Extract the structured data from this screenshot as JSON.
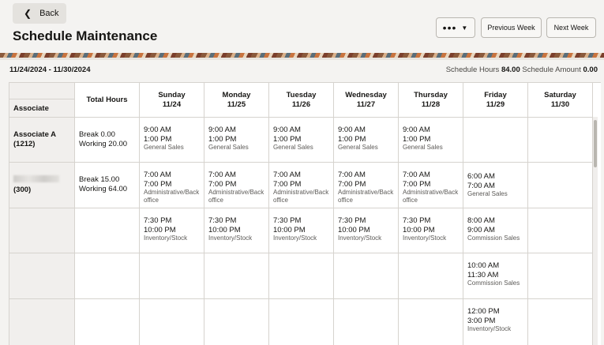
{
  "header": {
    "back_label": "Back",
    "title": "Schedule Maintenance",
    "more_label": "•••",
    "prev_label": "Previous Week",
    "next_label": "Next Week"
  },
  "summary": {
    "date_range": "11/24/2024 - 11/30/2024",
    "hours_label": "Schedule Hours",
    "hours_value": "84.00",
    "amount_label": "Schedule Amount",
    "amount_value": "0.00"
  },
  "columns": {
    "associate": "Associate",
    "total_hours": "Total Hours",
    "days": [
      {
        "name": "Sunday",
        "date": "11/24"
      },
      {
        "name": "Monday",
        "date": "11/25"
      },
      {
        "name": "Tuesday",
        "date": "11/26"
      },
      {
        "name": "Wednesday",
        "date": "11/27"
      },
      {
        "name": "Thursday",
        "date": "11/28"
      },
      {
        "name": "Friday",
        "date": "11/29"
      },
      {
        "name": "Saturday",
        "date": "11/30"
      }
    ]
  },
  "rows": [
    {
      "associate": "Associate A",
      "id": "(1212)",
      "break": "Break  0.00",
      "working": "Working  20.00",
      "shifts": [
        {
          "start": "9:00 AM",
          "end": "1:00 PM",
          "dept": "General Sales"
        },
        {
          "start": "9:00 AM",
          "end": "1:00 PM",
          "dept": "General Sales"
        },
        {
          "start": "9:00 AM",
          "end": "1:00 PM",
          "dept": "General Sales"
        },
        {
          "start": "9:00 AM",
          "end": "1:00 PM",
          "dept": "General Sales"
        },
        {
          "start": "9:00 AM",
          "end": "1:00 PM",
          "dept": "General Sales"
        },
        null,
        null
      ]
    },
    {
      "associate": "",
      "id": "(300)",
      "break": "Break  15.00",
      "working": "Working  64.00",
      "shifts": [
        {
          "start": "7:00 AM",
          "end": "7:00 PM",
          "dept": "Administrative/Back office"
        },
        {
          "start": "7:00 AM",
          "end": "7:00 PM",
          "dept": "Administrative/Back office"
        },
        {
          "start": "7:00 AM",
          "end": "7:00 PM",
          "dept": "Administrative/Back office"
        },
        {
          "start": "7:00 AM",
          "end": "7:00 PM",
          "dept": "Administrative/Back office"
        },
        {
          "start": "7:00 AM",
          "end": "7:00 PM",
          "dept": "Administrative/Back office"
        },
        {
          "start": "6:00 AM",
          "end": "7:00 AM",
          "dept": "General Sales"
        },
        null
      ]
    },
    {
      "shifts": [
        {
          "start": "7:30 PM",
          "end": "10:00 PM",
          "dept": "Inventory/Stock"
        },
        {
          "start": "7:30 PM",
          "end": "10:00 PM",
          "dept": "Inventory/Stock"
        },
        {
          "start": "7:30 PM",
          "end": "10:00 PM",
          "dept": "Inventory/Stock"
        },
        {
          "start": "7:30 PM",
          "end": "10:00 PM",
          "dept": "Inventory/Stock"
        },
        {
          "start": "7:30 PM",
          "end": "10:00 PM",
          "dept": "Inventory/Stock"
        },
        {
          "start": "8:00 AM",
          "end": "9:00 AM",
          "dept": "Commission Sales"
        },
        null
      ]
    },
    {
      "shifts": [
        null,
        null,
        null,
        null,
        null,
        {
          "start": "10:00 AM",
          "end": "11:30 AM",
          "dept": "Commission Sales"
        },
        null
      ]
    },
    {
      "shifts": [
        null,
        null,
        null,
        null,
        null,
        {
          "start": "12:00 PM",
          "end": "3:00 PM",
          "dept": "Inventory/Stock"
        },
        null
      ]
    }
  ]
}
